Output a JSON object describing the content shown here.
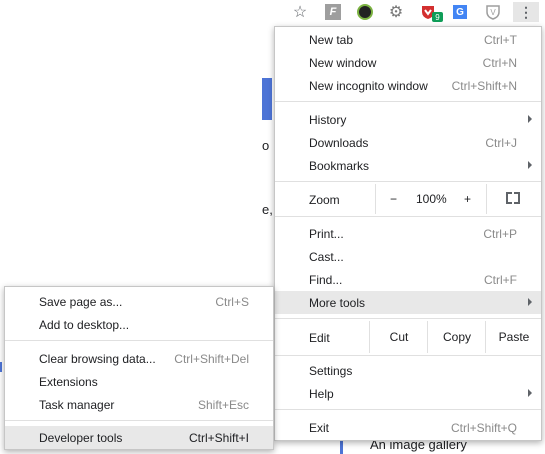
{
  "toolbar": {
    "bookmark_icon": "star-icon",
    "extensions": [
      {
        "icon": "f-extension-icon",
        "glyph": "F"
      },
      {
        "icon": "green-circle-extension-icon"
      },
      {
        "icon": "gear-extension-icon"
      },
      {
        "icon": "red-shield-extension-icon",
        "badge": "9"
      },
      {
        "icon": "translate-extension-icon",
        "glyph": "G"
      },
      {
        "icon": "v-shield-extension-icon",
        "glyph": "V"
      }
    ],
    "menu_icon": "three-dots-vertical-icon"
  },
  "page": {
    "fragment_1": "o",
    "fragment_2": "e,",
    "caption": "An image gallery"
  },
  "menu": {
    "new_tab": {
      "label": "New tab",
      "shortcut": "Ctrl+T"
    },
    "new_window": {
      "label": "New window",
      "shortcut": "Ctrl+N"
    },
    "new_incognito": {
      "label": "New incognito window",
      "shortcut": "Ctrl+Shift+N"
    },
    "history": {
      "label": "History"
    },
    "downloads": {
      "label": "Downloads",
      "shortcut": "Ctrl+J"
    },
    "bookmarks": {
      "label": "Bookmarks"
    },
    "zoom": {
      "label": "Zoom",
      "minus": "−",
      "value": "100%",
      "plus": "+"
    },
    "print": {
      "label": "Print...",
      "shortcut": "Ctrl+P"
    },
    "cast": {
      "label": "Cast..."
    },
    "find": {
      "label": "Find...",
      "shortcut": "Ctrl+F"
    },
    "more_tools": {
      "label": "More tools"
    },
    "edit": {
      "label": "Edit",
      "cut": "Cut",
      "copy": "Copy",
      "paste": "Paste"
    },
    "settings": {
      "label": "Settings"
    },
    "help": {
      "label": "Help"
    },
    "exit": {
      "label": "Exit",
      "shortcut": "Ctrl+Shift+Q"
    }
  },
  "submenu": {
    "save_page": {
      "label": "Save page as...",
      "shortcut": "Ctrl+S"
    },
    "add_desktop": {
      "label": "Add to desktop..."
    },
    "clear_data": {
      "label": "Clear browsing data...",
      "shortcut": "Ctrl+Shift+Del"
    },
    "extensions": {
      "label": "Extensions"
    },
    "task_manager": {
      "label": "Task manager",
      "shortcut": "Shift+Esc"
    },
    "dev_tools": {
      "label": "Developer tools",
      "shortcut": "Ctrl+Shift+I"
    }
  }
}
